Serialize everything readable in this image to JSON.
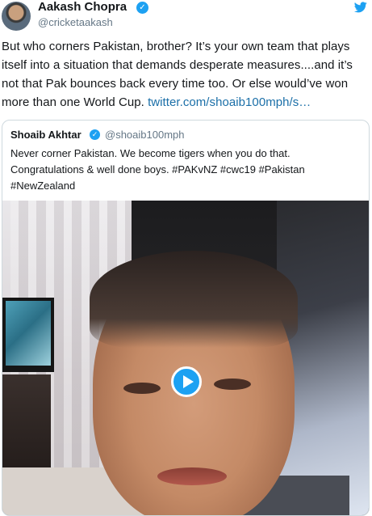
{
  "tweet": {
    "display_name": "Aakash Chopra",
    "handle": "@cricketaakash",
    "verified_icon": "verified-badge-icon",
    "platform_icon": "twitter-bird-icon",
    "text": "But who corners Pakistan, brother? It’s your own team that plays itself into a situation that demands desperate measures....and it’s not that Pak bounces back every time too. Or else would’ve won more than one World Cup.",
    "link_text": "twitter.com/shoaib100mph/s…"
  },
  "quote": {
    "display_name": "Shoaib Akhtar",
    "handle": "@shoaib100mph",
    "text": "Never corner Pakistan. We become tigers when you do that. Congratulations & well done boys. #PAKvNZ #cwc19 #Pakistan #NewZealand",
    "media_type": "video",
    "play_icon": "play-icon"
  },
  "colors": {
    "accent": "#1da1f2",
    "link": "#1b6fa8",
    "muted": "#657786",
    "border": "#cfd9de"
  }
}
